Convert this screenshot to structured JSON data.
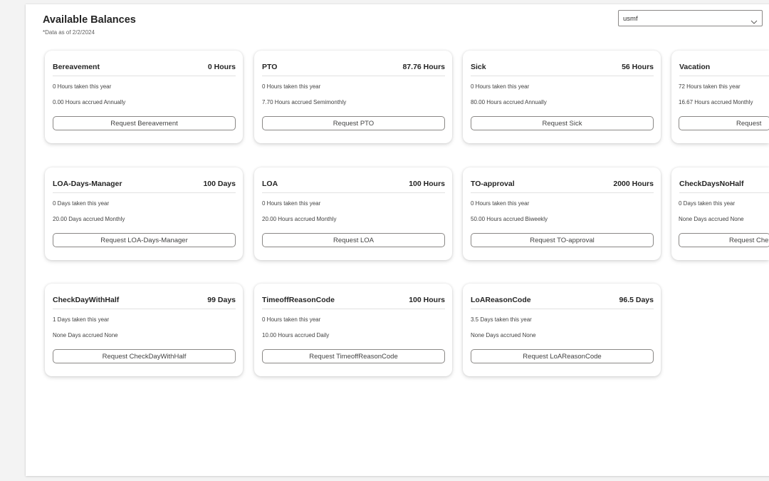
{
  "header": {
    "title": "Available Balances",
    "subtitle": "*Data as of 2/2/2024"
  },
  "company_select": {
    "value": "usmf",
    "icon": "chevron-down-icon"
  },
  "cards": [
    {
      "name": "Bereavement",
      "balance": "0 Hours",
      "taken": "0 Hours taken this year",
      "accrued": "0.00 Hours accrued Annually",
      "button": "Request Bereavement"
    },
    {
      "name": "PTO",
      "balance": "87.76 Hours",
      "taken": "0 Hours taken this year",
      "accrued": "7.70 Hours accrued Semimonthly",
      "button": "Request PTO"
    },
    {
      "name": "Sick",
      "balance": "56 Hours",
      "taken": "0 Hours taken this year",
      "accrued": "80.00 Hours accrued Annually",
      "button": "Request Sick"
    },
    {
      "name": "Vacation",
      "balance": "",
      "taken": "72 Hours taken this year",
      "accrued": "16.67 Hours accrued Monthly",
      "button": "Request"
    },
    {
      "name": "LOA-Days-Manager",
      "balance": "100 Days",
      "taken": "0 Days taken this year",
      "accrued": "20.00 Days accrued Monthly",
      "button": "Request LOA-Days-Manager"
    },
    {
      "name": "LOA",
      "balance": "100 Hours",
      "taken": "0 Hours taken this year",
      "accrued": "20.00 Hours accrued Monthly",
      "button": "Request LOA"
    },
    {
      "name": "TO-approval",
      "balance": "2000 Hours",
      "taken": "0 Hours taken this year",
      "accrued": "50.00 Hours accrued Biweekly",
      "button": "Request TO-approval"
    },
    {
      "name": "CheckDaysNoHalf",
      "balance": "",
      "taken": "0 Days taken this year",
      "accrued": "None Days accrued None",
      "button": "Request Che"
    },
    {
      "name": "CheckDayWithHalf",
      "balance": "99 Days",
      "taken": "1 Days taken this year",
      "accrued": "None Days accrued None",
      "button": "Request CheckDayWithHalf"
    },
    {
      "name": "TimeoffReasonCode",
      "balance": "100 Hours",
      "taken": "0 Hours taken this year",
      "accrued": "10.00 Hours accrued Daily",
      "button": "Request TimeoffReasonCode"
    },
    {
      "name": "LoAReasonCode",
      "balance": "96.5 Days",
      "taken": "3.5 Days taken this year",
      "accrued": "None Days accrued None",
      "button": "Request LoAReasonCode"
    }
  ]
}
